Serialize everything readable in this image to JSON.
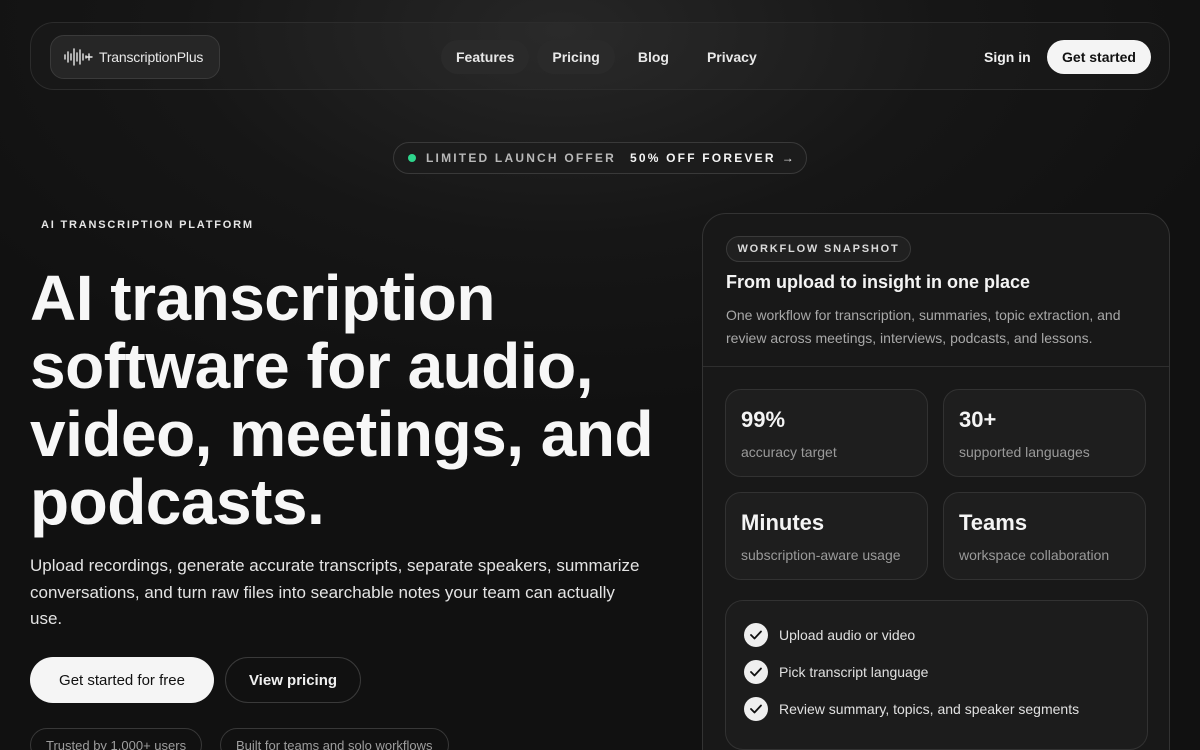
{
  "brand": {
    "name": "TranscriptionPlus"
  },
  "nav": {
    "links": [
      "Features",
      "Pricing",
      "Blog",
      "Privacy"
    ],
    "active": "Pricing",
    "signin": "Sign in",
    "cta": "Get started"
  },
  "offer": {
    "label": "LIMITED LAUNCH OFFER",
    "highlight": "50% OFF FOREVER",
    "arrow": "→",
    "dot_color": "#2ed58c"
  },
  "hero": {
    "eyebrow": "AI TRANSCRIPTION PLATFORM",
    "headline": "AI transcription software for audio, video, meetings, and podcasts.",
    "subtext": "Upload recordings, generate accurate transcripts, separate speakers, summarize conversations, and turn raw files into searchable notes your team can actually use.",
    "cta_primary": "Get started for free",
    "cta_secondary": "View pricing",
    "trust_badges": [
      "Trusted by 1,000+ users",
      "Built for teams and solo workflows"
    ]
  },
  "card": {
    "tag": "WORKFLOW SNAPSHOT",
    "title": "From upload to insight in one place",
    "description": "One workflow for transcription, summaries, topic extraction, and review across meetings, interviews, podcasts, and lessons.",
    "stats": [
      {
        "value": "99%",
        "label": "accuracy target"
      },
      {
        "value": "30+",
        "label": "supported languages"
      },
      {
        "value": "Minutes",
        "label": "subscription-aware usage"
      },
      {
        "value": "Teams",
        "label": "workspace collaboration"
      }
    ],
    "steps": [
      "Upload audio or video",
      "Pick transcript language",
      "Review summary, topics, and speaker segments"
    ]
  },
  "icons": {
    "logo": "waveform-icon",
    "check": "check-icon",
    "status_dot": "status-dot-icon"
  }
}
